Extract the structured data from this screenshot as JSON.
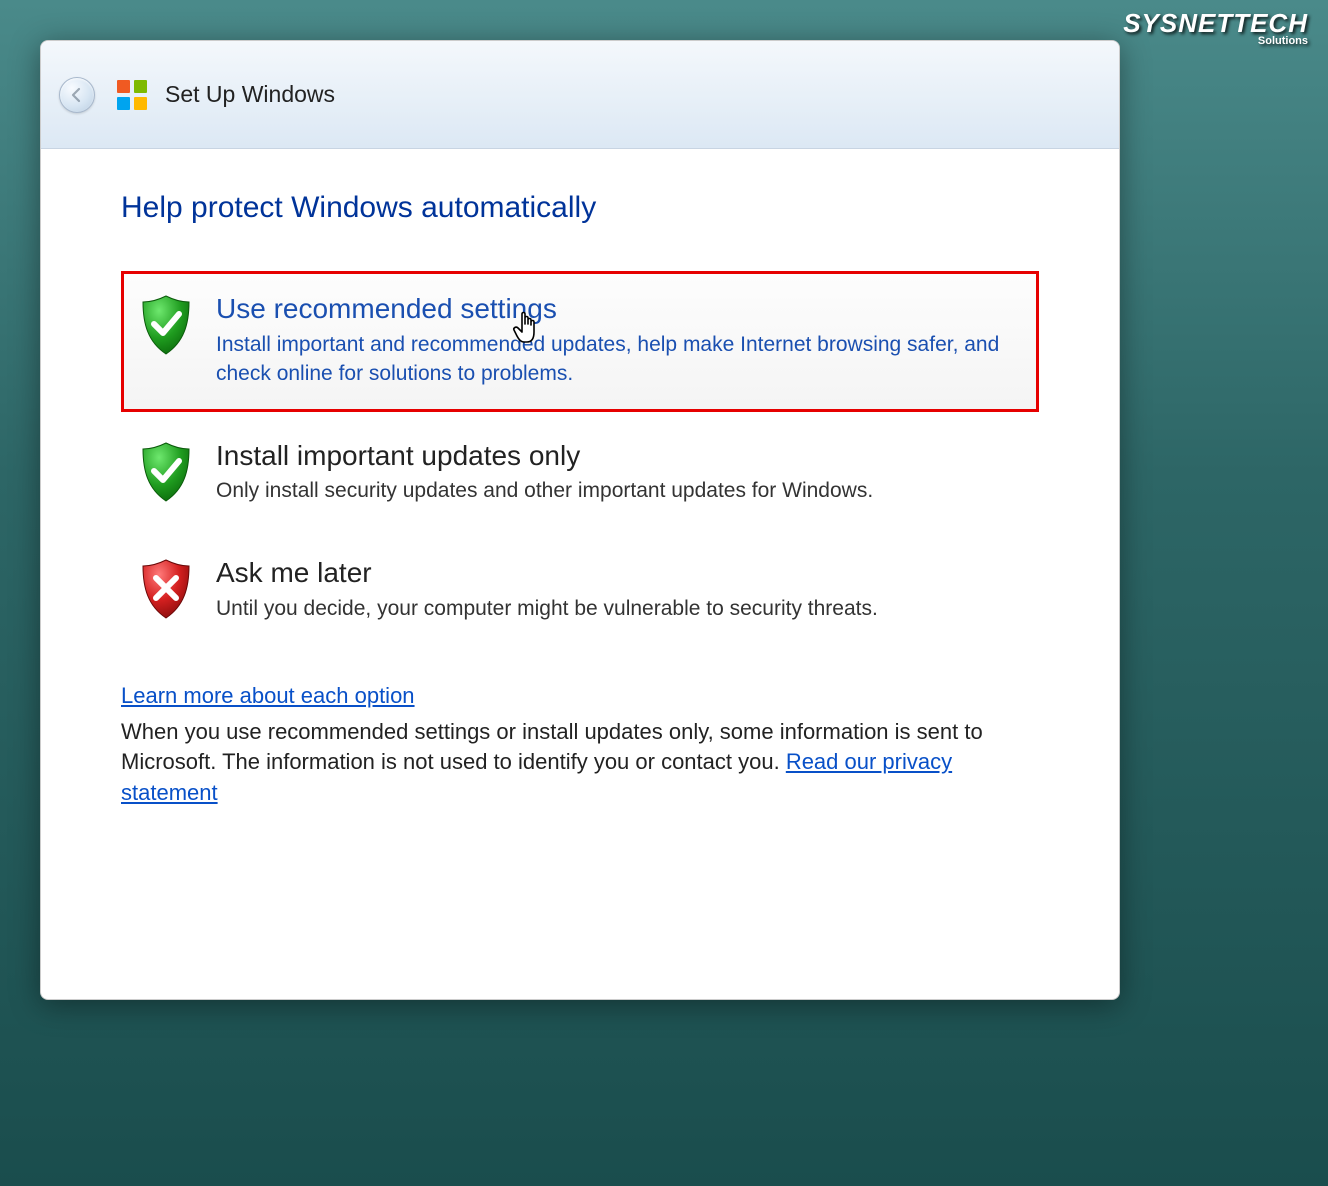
{
  "watermark": {
    "main": "SYSNETTECH",
    "sub": "Solutions"
  },
  "titlebar": {
    "text": "Set Up Windows"
  },
  "page": {
    "title": "Help protect Windows automatically"
  },
  "options": [
    {
      "title": "Use recommended settings",
      "desc": "Install important and recommended updates, help make Internet browsing safer, and check online for solutions to problems.",
      "highlighted": true,
      "shield": "green-check"
    },
    {
      "title": "Install important updates only",
      "desc": "Only install security updates and other important updates for Windows.",
      "highlighted": false,
      "shield": "green-check"
    },
    {
      "title": "Ask me later",
      "desc": "Until you decide, your computer might be vulnerable to security threats.",
      "highlighted": false,
      "shield": "red-x"
    }
  ],
  "footer": {
    "learn_link": "Learn more about each option",
    "text_before": "When you use recommended settings or install updates only, some information is sent to Microsoft. The information is not used to identify you or contact you. ",
    "privacy_link": "Read our privacy statement"
  }
}
